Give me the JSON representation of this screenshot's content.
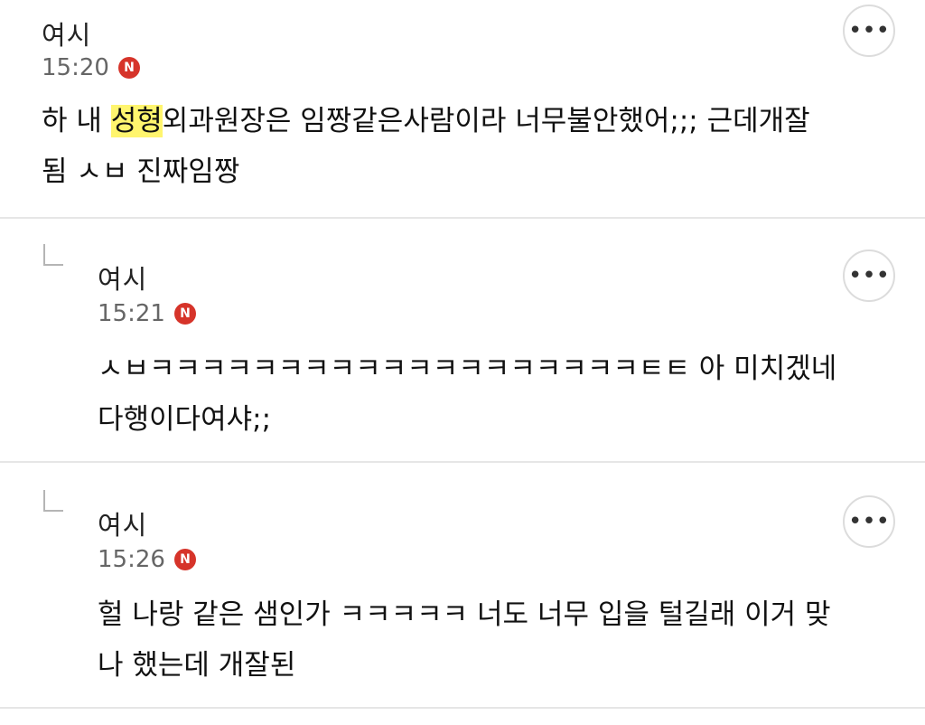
{
  "comments": [
    {
      "author": "여시",
      "time": "15:20",
      "badge": "N",
      "more": "•••",
      "text_pre": "하 내 ",
      "text_highlight": "성형",
      "text_post": "외과원장은 임짱같은사람이라 너무불안했어;;; 근데개잘\n됨 ㅅㅂ 진짜임짱"
    },
    {
      "author": "여시",
      "time": "15:21",
      "badge": "N",
      "more": "•••",
      "text": "ㅅㅂㅋㅋㅋㅋㅋㅋㅋㅋㅋㅋㅋㅋㅋㅋㅋㅋㅋㅋㅋㅌㅌ 아 미치겠네\n다행이다여샤;;"
    },
    {
      "author": "여시",
      "time": "15:26",
      "badge": "N",
      "more": "•••",
      "text": "헐 나랑 같은 샘인가 ㅋㅋㅋㅋㅋ 너도 너무 입을 털길래 이거 맞\n나 했는데 개잘된"
    }
  ],
  "colors": {
    "badge": "#d6342a",
    "highlight": "#fff56e",
    "divider": "#e6e6e6"
  }
}
